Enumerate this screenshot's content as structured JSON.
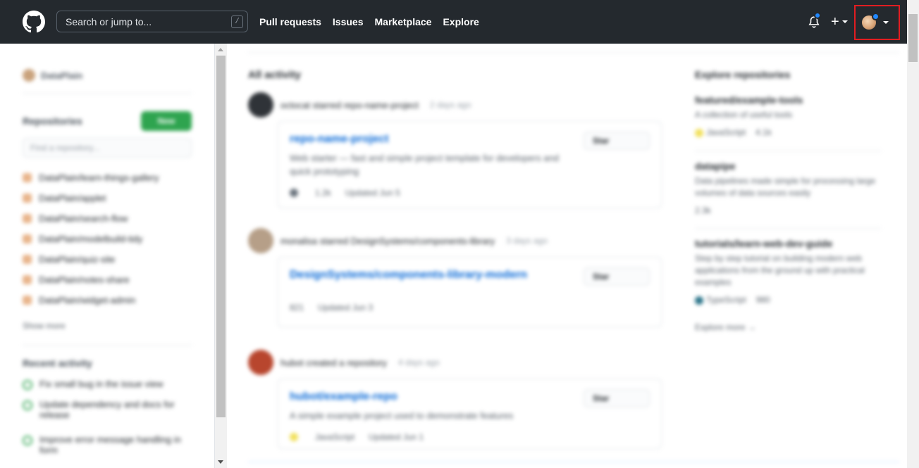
{
  "header": {
    "search_placeholder": "Search or jump to...",
    "search_shortcut": "/",
    "nav": [
      "Pull requests",
      "Issues",
      "Marketplace",
      "Explore"
    ],
    "plus_label": "+"
  },
  "sidebar": {
    "user": "DataPlain",
    "repositories_title": "Repositories",
    "new_label": "New",
    "find_placeholder": "Find a repository...",
    "repos": [
      "DataPlain/learn-things-gallery",
      "DataPlain/applet",
      "DataPlain/search-flow",
      "DataPlain/modelbuild-tidy",
      "DataPlain/quiz-site",
      "DataPlain/notes-share",
      "DataPlain/widget-admin"
    ],
    "show_more": "Show more",
    "recent_title": "Recent activity",
    "recent": [
      "Fix small bug in the issue view",
      "Update dependency and docs for release",
      "Improve error message handling in form"
    ]
  },
  "feed": {
    "title": "All activity",
    "events": [
      {
        "head": "octocat starred repo-name-project",
        "time": "2 days ago",
        "avatar_color": "#2f3338",
        "card_title": "repo-name-project",
        "card_desc": "Web starter — fast and simple project template for developers and quick prototyping",
        "meta": [
          "1.2k",
          "Updated Jun 5"
        ],
        "star_label": "Star",
        "lang_color": "#6a737d"
      },
      {
        "head": "monalisa starred DesignSystems/components-library",
        "time": "3 days ago",
        "avatar_color": "#b69f88",
        "card_title": "DesignSystems/components-library-modern",
        "card_desc": "",
        "meta": [
          "821",
          "Updated Jun 3"
        ],
        "star_label": "Star",
        "lang_color": "#6a737d"
      },
      {
        "head": "hubot created a repository",
        "time": "4 days ago",
        "avatar_color": "#b8462e",
        "card_title": "hubot/example-repo",
        "card_desc": "A simple example project used to demonstrate features",
        "meta": [
          "JavaScript",
          "Updated Jun 1"
        ],
        "star_label": "Star",
        "lang_color": "#f1e05a"
      }
    ]
  },
  "explore": {
    "title": "Explore repositories",
    "items": [
      {
        "name": "featured/example-tools",
        "desc": "A collection of useful tools",
        "meta": [
          "JavaScript",
          "4.1k"
        ],
        "lang_color": "#f1e05a"
      },
      {
        "name": "datapipe",
        "desc": "Data pipelines made simple for processing large volumes of data sources easily",
        "meta": [
          "2.3k"
        ],
        "lang_color": "#e1e4e8"
      },
      {
        "name": "tutorials/learn-web-dev-guide",
        "desc": "Step by step tutorial on building modern web applications from the ground up with practical examples",
        "meta": [
          "TypeScript",
          "980"
        ],
        "lang_color": "#2b7489"
      }
    ],
    "more": "Explore more →"
  },
  "colors": {
    "header_bg": "#24292e",
    "accent_blue": "#2188ff",
    "highlight_border": "#e11d21",
    "new_green": "#2ea44f"
  }
}
